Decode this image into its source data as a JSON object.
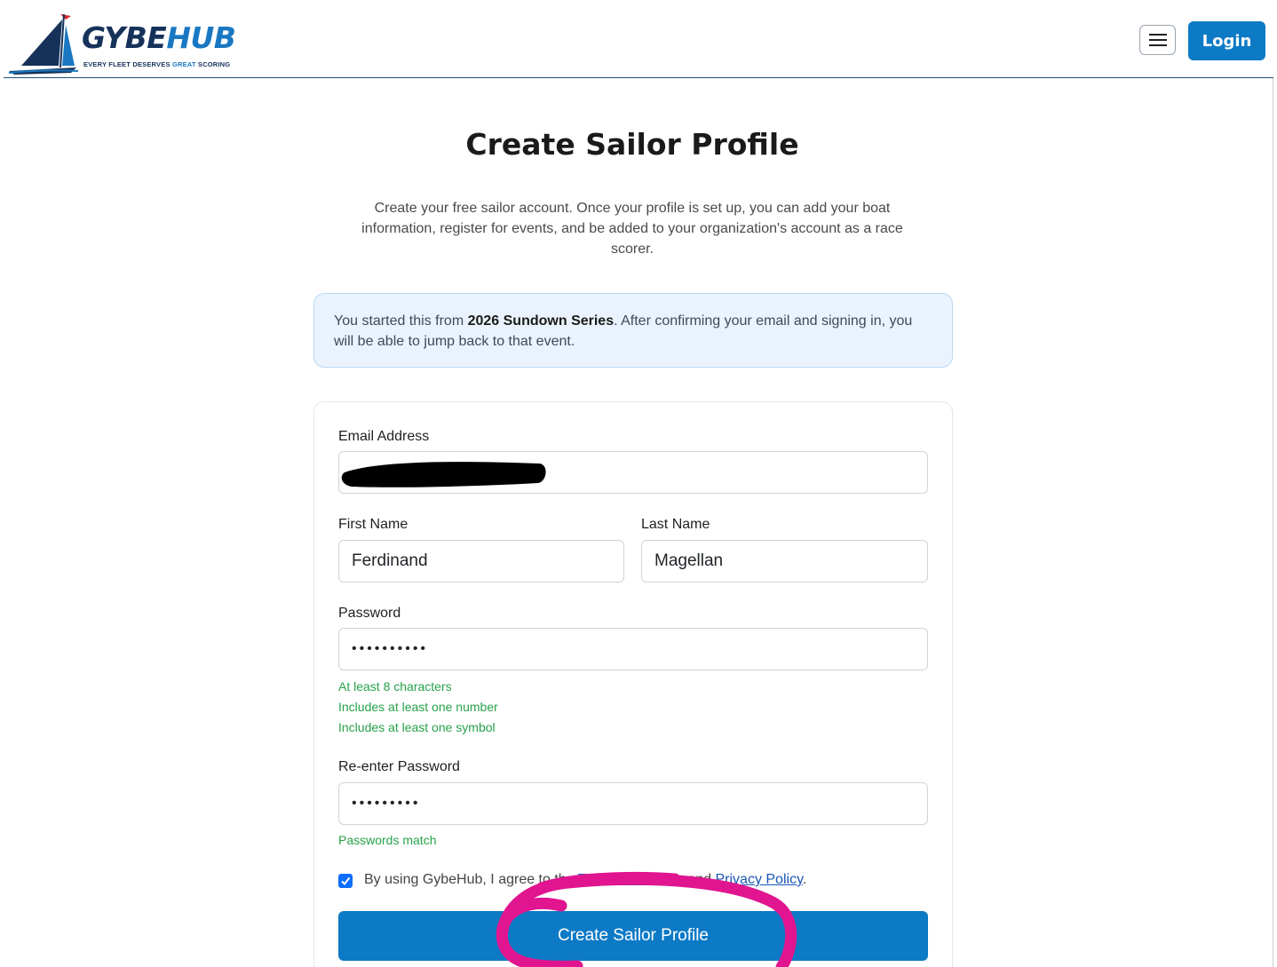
{
  "header": {
    "logo_word_1": "GYBE",
    "logo_word_2": "HUB",
    "tagline_a": "EVERY FLEET DESERVES ",
    "tagline_b": "GREAT",
    "tagline_c": " SCORING",
    "menu_icon": "hamburger-icon",
    "login_label": "Login"
  },
  "page": {
    "title": "Create Sailor Profile",
    "intro": "Create your free sailor account. Once your profile is set up, you can add your boat information, register for events, and be added to your organization's account as a race scorer.",
    "alert_prefix": "You started this from ",
    "alert_event": "2026 Sundown Series",
    "alert_suffix": ". After confirming your email and signing in, you will be able to jump back to that event."
  },
  "form": {
    "email_label": "Email Address",
    "first_name_label": "First Name",
    "first_name_value": "Ferdinand",
    "last_name_label": "Last Name",
    "last_name_value": "Magellan",
    "password_label": "Password",
    "password_mask": "••••••••••",
    "rules": [
      "At least 8 characters",
      "Includes at least one number",
      "Includes at least one symbol"
    ],
    "reenter_label": "Re-enter Password",
    "reenter_mask": "•••••••••",
    "match_text": "Passwords match",
    "agree_prefix": "By using GybeHub, I agree to the ",
    "terms_link": "Terms of Service",
    "agree_and": " and ",
    "privacy_link": "Privacy Policy",
    "agree_end": ".",
    "agree_checked": true,
    "submit_label": "Create Sailor Profile"
  },
  "colors": {
    "primary": "#0d7ac6",
    "navy": "#16325a",
    "success": "#27a24a",
    "annotation": "#e0158f"
  }
}
